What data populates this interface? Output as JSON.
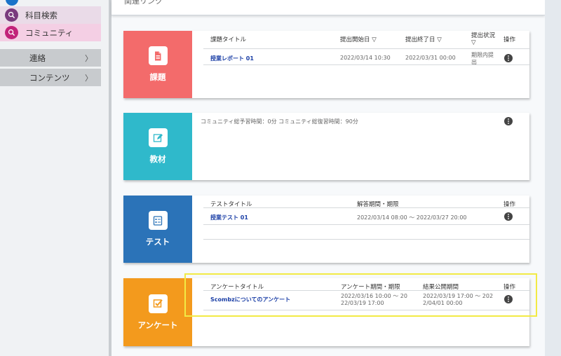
{
  "sidebar": {
    "search_label": "科目検索",
    "community_label": "コミュニティ",
    "nav": [
      {
        "label": "連絡",
        "chevron": "〉"
      },
      {
        "label": "コンテンツ",
        "chevron": "〉"
      }
    ]
  },
  "header": {
    "title": "関連リンク"
  },
  "assignment": {
    "tile_label": "課題",
    "col_title": "課題タイトル",
    "col_start": "提出開始日 ▽",
    "col_end": "提出終了日 ▽",
    "col_status": "提出状況 ▽",
    "col_ops": "操作",
    "rows": [
      {
        "title": "授業レポート 01",
        "start": "2022/03/14 10:30",
        "end": "2022/03/31 00:00",
        "status": "期限内提出"
      }
    ]
  },
  "material": {
    "tile_label": "教材",
    "summary": "コミュニティ総予習時間：0分 コミュニティ総復習時間：90分"
  },
  "test": {
    "tile_label": "テスト",
    "col_title": "テストタイトル",
    "col_period": "解答期間・期限",
    "col_ops": "操作",
    "rows": [
      {
        "title": "授業テスト 01",
        "period": "2022/03/14 08:00 ～ 2022/03/27 20:00"
      }
    ]
  },
  "survey": {
    "tile_label": "アンケート",
    "col_title": "アンケートタイトル",
    "col_period": "アンケート期間・期限",
    "col_result": "結果公開期間",
    "col_ops": "操作",
    "rows": [
      {
        "title": "Scombzについてのアンケート",
        "period": "2022/03/16 10:00 ～ 2022/03/19 17:00",
        "result": "2022/03/19 17:00 ～ 2022/04/01 00:00"
      }
    ]
  },
  "colors": {
    "assignment": "#f36b6b",
    "material": "#2fb9cb",
    "test": "#2b73b8",
    "survey": "#f39a1d",
    "highlight": "#f2ea45"
  }
}
